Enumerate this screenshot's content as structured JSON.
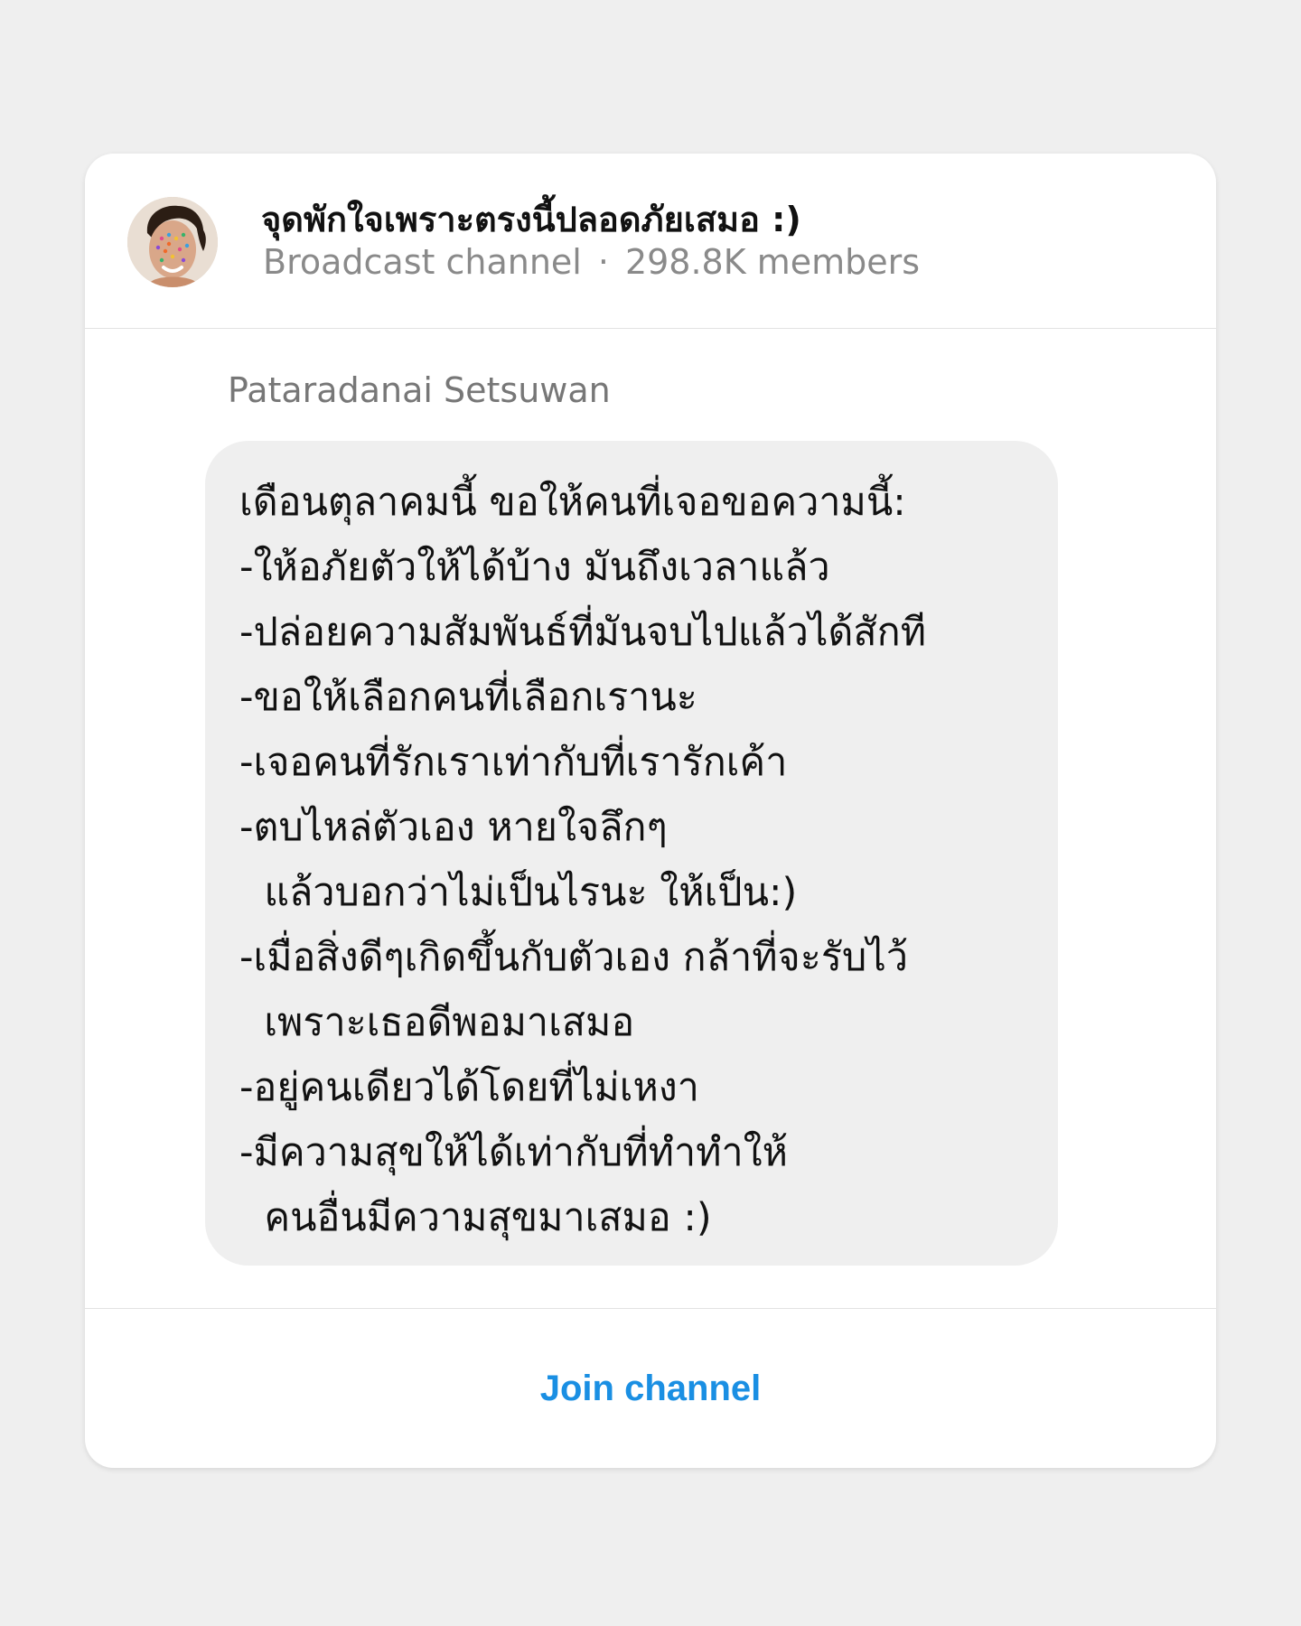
{
  "channel": {
    "name": "จุดพักใจเพราะตรงนี้ปลอดภัยเสมอ :)",
    "type": "Broadcast channel",
    "separator": "·",
    "members": "298.8K members"
  },
  "message": {
    "sender": "Pataradanai Setsuwan",
    "text": "เดือนตุลาคมนี้ ขอให้คนที่เจอขอความนี้:\n-ให้อภัยตัวให้ได้บ้าง มันถึงเวลาแล้ว\n-ปล่อยความสัมพันธ์ที่มันจบไปแล้วได้สักที\n-ขอให้เลือกคนที่เลือกเรานะ\n-เจอคนที่รักเราเท่ากับที่เรารักเค้า\n-ตบไหล่ตัวเอง หายใจลึกๆ\n  แล้วบอกว่าไม่เป็นไรนะ ให้เป็น:)\n-เมื่อสิ่งดีๆเกิดขึ้นกับตัวเอง กล้าที่จะรับไว้\n  เพราะเธอดีพอมาเสมอ\n-อยู่คนเดียวได้โดยที่ไม่เหงา\n-มีความสุขให้ได้เท่ากับที่ทำทำให้\n  คนอื่นมีความสุขมาเสมอ :)"
  },
  "footer": {
    "join_label": "Join channel"
  },
  "icons": {
    "avatar": "channel-avatar"
  },
  "colors": {
    "accent": "#1a8fe3",
    "bubble": "#efefef",
    "background": "#efefef"
  }
}
